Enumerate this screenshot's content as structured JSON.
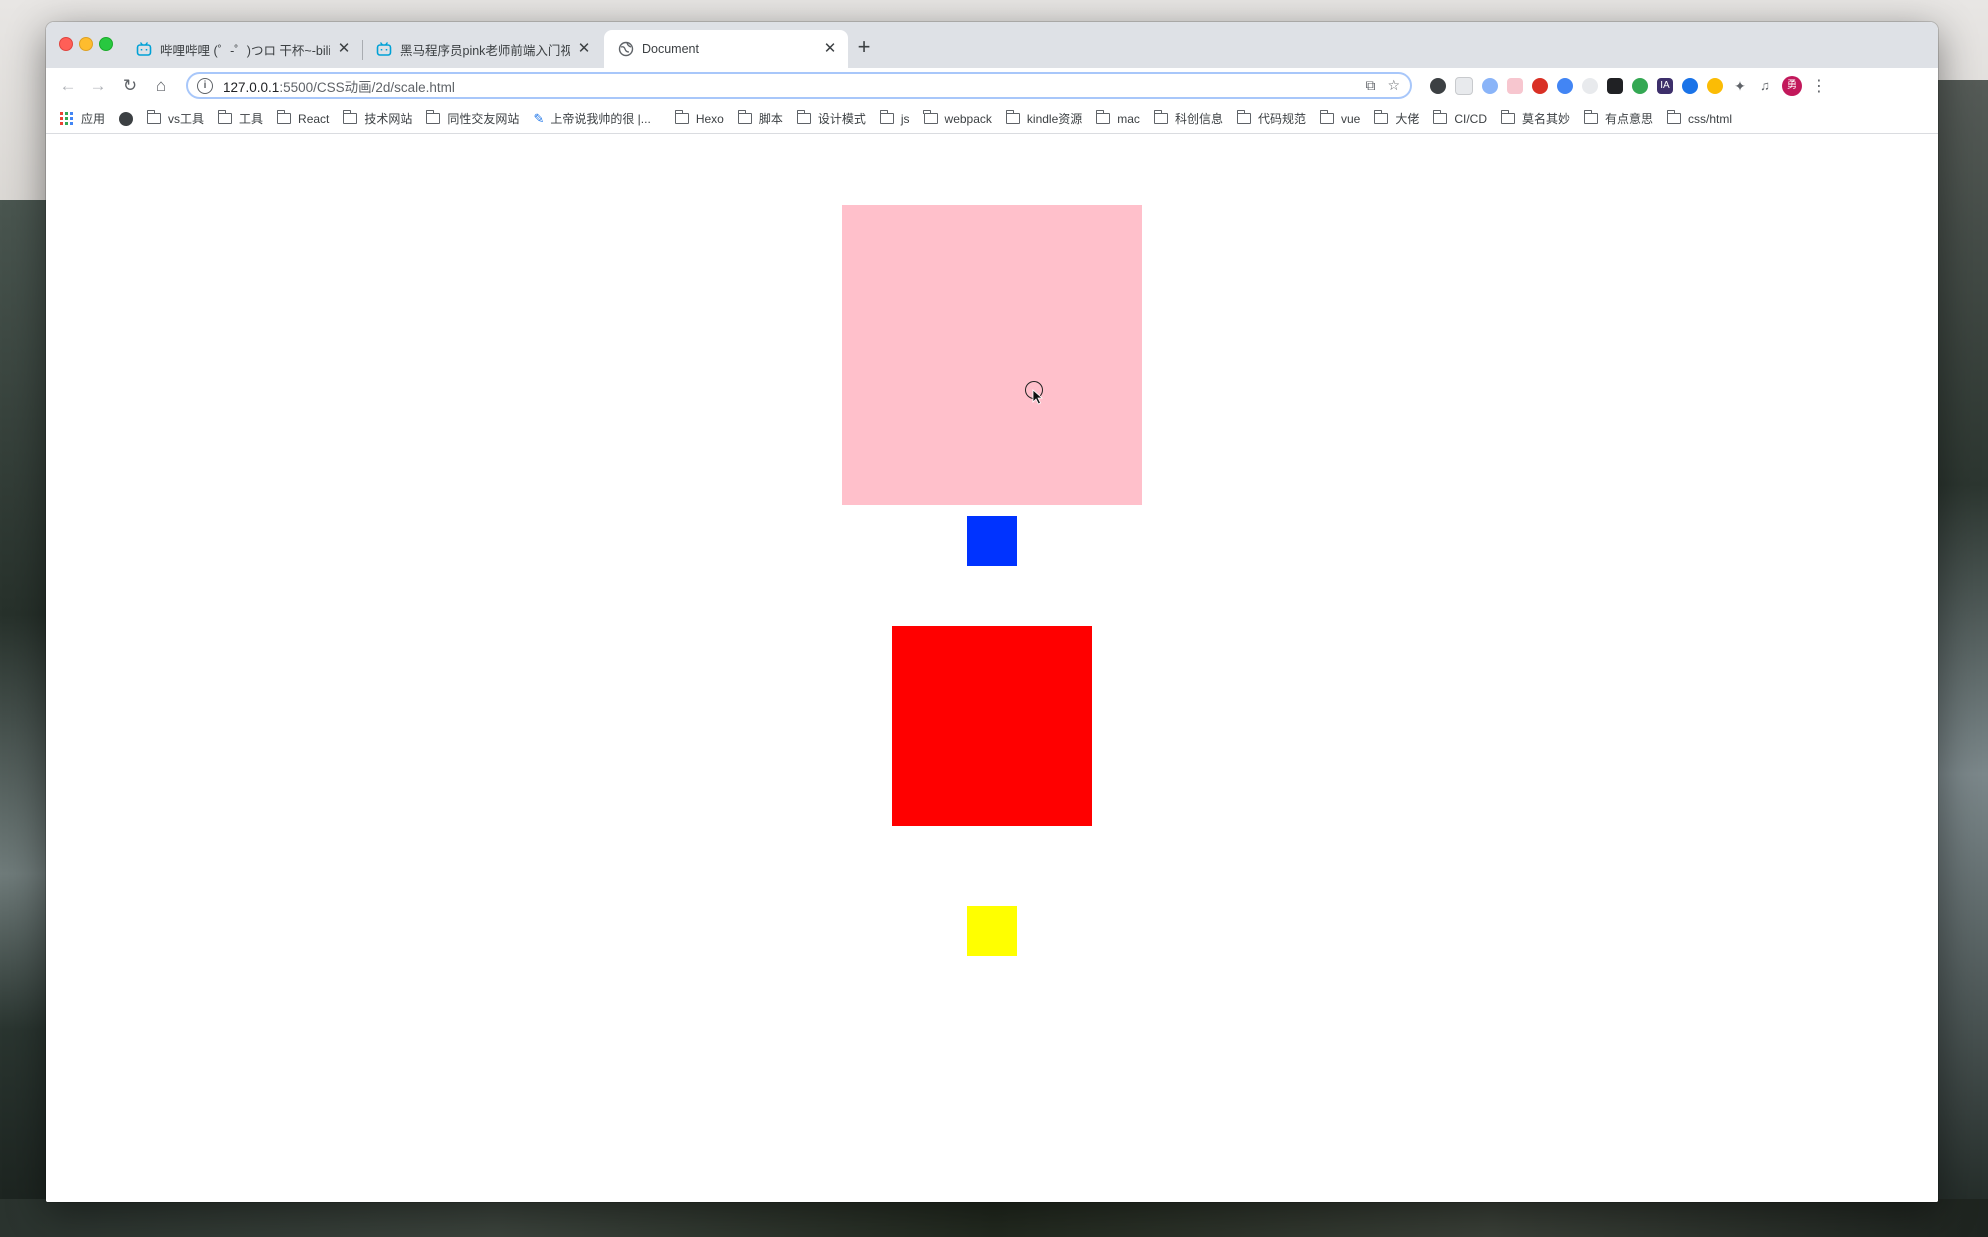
{
  "browser": {
    "tabs": [
      {
        "title": "哔哩哔哩 (゜-゜)つロ 干杯~-bilibili",
        "icon": "bilibili-icon",
        "active": false
      },
      {
        "title": "黑马程序员pink老师前端入门视频",
        "icon": "bilibili-icon",
        "active": false
      },
      {
        "title": "Document",
        "icon": "globe-icon",
        "active": true
      }
    ],
    "new_tab_label": "+",
    "url_host": "127.0.0.1",
    "url_path": ":5500/CSS动画/2d/scale.html",
    "avatar_label": "勇"
  },
  "bookmarks": [
    {
      "label": "应用",
      "type": "apps"
    },
    {
      "label": "",
      "type": "globe"
    },
    {
      "label": "vs工具",
      "type": "folder"
    },
    {
      "label": "工具",
      "type": "folder"
    },
    {
      "label": "React",
      "type": "folder"
    },
    {
      "label": "技术网站",
      "type": "folder"
    },
    {
      "label": "同性交友网站",
      "type": "folder"
    },
    {
      "label": "上帝说我帅的很 |...",
      "type": "link"
    },
    {
      "label": "Hexo",
      "type": "folder"
    },
    {
      "label": "脚本",
      "type": "folder"
    },
    {
      "label": "设计模式",
      "type": "folder"
    },
    {
      "label": "js",
      "type": "folder"
    },
    {
      "label": "webpack",
      "type": "folder"
    },
    {
      "label": "kindle资源",
      "type": "folder"
    },
    {
      "label": "mac",
      "type": "folder"
    },
    {
      "label": "科创信息",
      "type": "folder"
    },
    {
      "label": "代码规范",
      "type": "folder"
    },
    {
      "label": "vue",
      "type": "folder"
    },
    {
      "label": "大佬",
      "type": "folder"
    },
    {
      "label": "CI/CD",
      "type": "folder"
    },
    {
      "label": "莫名其妙",
      "type": "folder"
    },
    {
      "label": "有点意思",
      "type": "folder"
    },
    {
      "label": "css/html",
      "type": "folder"
    }
  ],
  "page": {
    "boxes": [
      {
        "name": "pink-box",
        "color": "#ffc0cb"
      },
      {
        "name": "blue-box",
        "color": "#0033ff"
      },
      {
        "name": "red-box",
        "color": "#ff0000"
      },
      {
        "name": "yellow-box",
        "color": "#ffff00"
      }
    ]
  }
}
